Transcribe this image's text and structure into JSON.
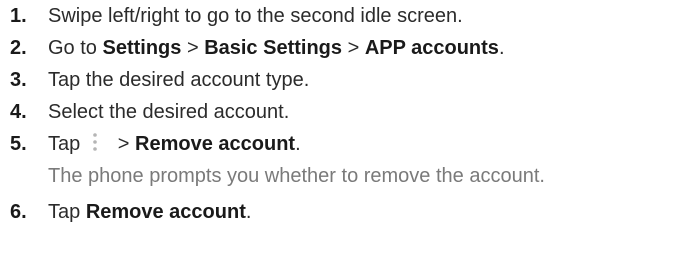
{
  "steps": [
    {
      "num": "1.",
      "text": "Swipe left/right to go to the second idle screen."
    },
    {
      "num": "2.",
      "pre": "Go to ",
      "b1": "Settings",
      "sep1": " > ",
      "b2": "Basic Settings",
      "sep2": " > ",
      "b3": "APP accounts",
      "end": "."
    },
    {
      "num": "3.",
      "text": "Tap the desired account type."
    },
    {
      "num": "4.",
      "text": "Select the desired account."
    },
    {
      "num": "5.",
      "pre": "Tap",
      "icon": "more-vertical-icon",
      "sep": " > ",
      "b1": "Remove account",
      "end": ".",
      "note": "The phone prompts you whether to remove the account."
    },
    {
      "num": "6.",
      "pre": "Tap ",
      "b1": "Remove account",
      "end": "."
    }
  ]
}
